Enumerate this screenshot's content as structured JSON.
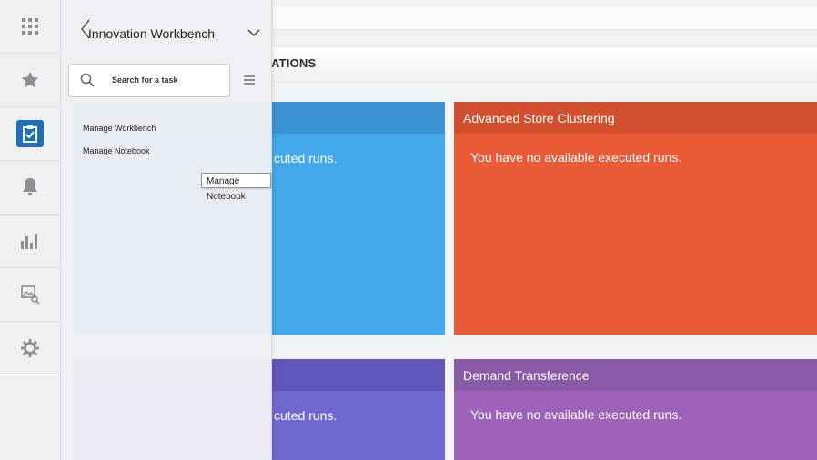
{
  "rail": {
    "items": [
      {
        "icon": "app-grid-icon"
      },
      {
        "icon": "star-icon"
      },
      {
        "icon": "clipboard-check-icon",
        "active": true
      },
      {
        "icon": "bell-icon"
      },
      {
        "icon": "bar-chart-icon"
      },
      {
        "icon": "image-search-icon"
      },
      {
        "icon": "gear-icon"
      }
    ],
    "accent": "#1f6fb7"
  },
  "panel": {
    "title": "Innovation Workbench",
    "search_placeholder": "Search for a task",
    "menu": [
      {
        "label": "Manage Workbench"
      },
      {
        "label": "Manage Notebook"
      }
    ],
    "tooltip": "Manage Notebook"
  },
  "main": {
    "section_title_visible": "ATIONS",
    "cards": [
      {
        "title": "",
        "message_visible": "cuted runs.",
        "color": "#42a8e9"
      },
      {
        "title": "Advanced Store Clustering",
        "message": "You have no available executed runs.",
        "color": "#e95b36"
      },
      {
        "title": "",
        "message_visible": "cuted runs.",
        "color": "#7067cf"
      },
      {
        "title": "Demand Transference",
        "message": "You have no available executed runs.",
        "color": "#9c63b8"
      }
    ]
  }
}
